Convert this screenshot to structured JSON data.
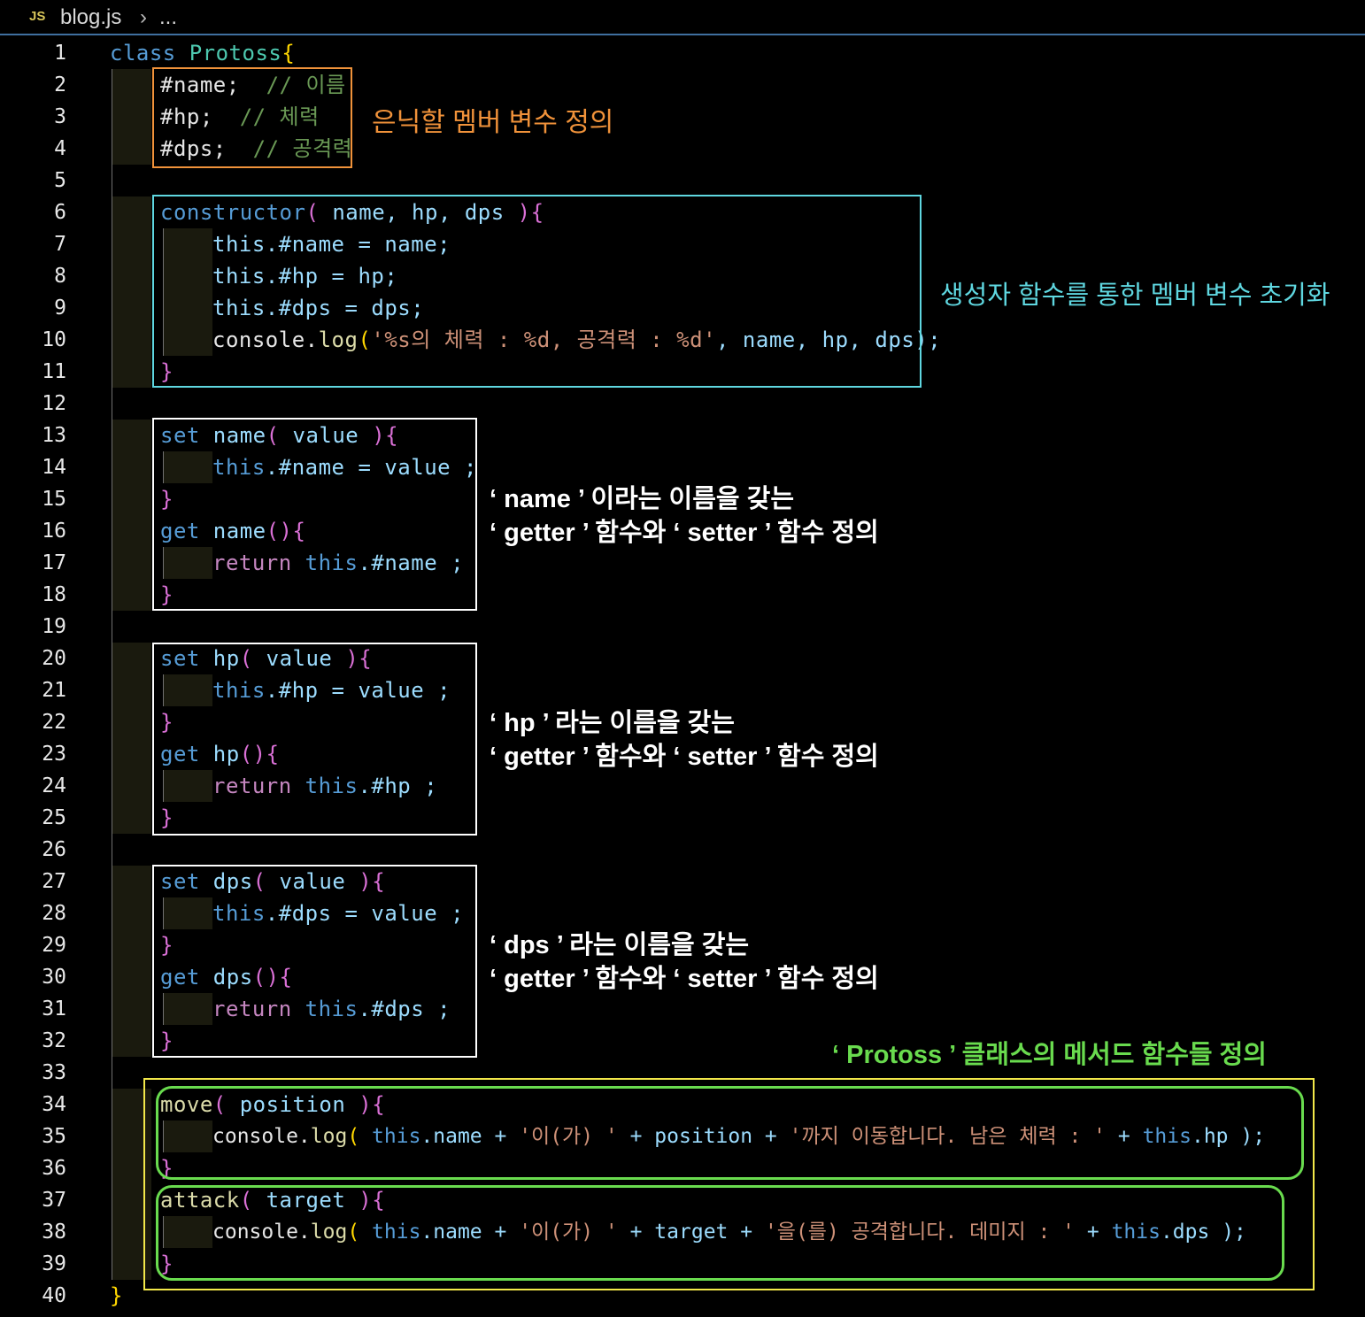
{
  "tab": {
    "icon_text": "JS",
    "filename": "blog.js",
    "chevron": "›",
    "more": "..."
  },
  "line_numbers": [
    "1",
    "2",
    "3",
    "4",
    "5",
    "6",
    "7",
    "8",
    "9",
    "10",
    "11",
    "12",
    "13",
    "14",
    "15",
    "16",
    "17",
    "18",
    "19",
    "20",
    "21",
    "22",
    "23",
    "24",
    "25",
    "26",
    "27",
    "28",
    "29",
    "30",
    "31",
    "32",
    "33",
    "34",
    "35",
    "36",
    "37",
    "38",
    "39",
    "40"
  ],
  "code": {
    "l1_class": "class",
    "l1_name": "Protoss",
    "l1_brace": "{",
    "l2_field": "#name;",
    "l2_comment": "// 이름",
    "l3_field": "#hp;",
    "l3_comment": "// 체력",
    "l4_field": "#dps;",
    "l4_comment": "// 공격력",
    "l6_kw": "constructor",
    "l6_open": "(",
    "l6_params": " name, hp, dps ",
    "l6_close": "){",
    "l7": "this.#name = name;",
    "l8": "this.#hp = hp;",
    "l9": "this.#dps = dps;",
    "l10_a": "console.",
    "l10_b": "log",
    "l10_c": "(",
    "l10_str": "'%s의 체력 : %d, 공격력 : %d'",
    "l10_d": ", name, hp, dps);",
    "close_brace": "}",
    "l13_kw": "set",
    "l13_name": " name",
    "l13_open": "(",
    "l13_param": " value ",
    "l13_close": "){",
    "l14_this": "this",
    "l14_rest": ".#name = value ;",
    "l16_kw": "get",
    "l16_name": " name",
    "l16_close": "(){",
    "l17_ret": "return",
    "l17_this": " this",
    "l17_rest": ".#name ;",
    "l20_kw": "set",
    "l20_name": " hp",
    "l20_open": "(",
    "l20_param": " value ",
    "l20_close": "){",
    "l21_this": "this",
    "l21_rest": ".#hp = value ;",
    "l23_kw": "get",
    "l23_name": " hp",
    "l23_close": "(){",
    "l24_ret": "return",
    "l24_this": " this",
    "l24_rest": ".#hp ;",
    "l27_kw": "set",
    "l27_name": " dps",
    "l27_open": "(",
    "l27_param": " value ",
    "l27_close": "){",
    "l28_this": "this",
    "l28_rest": ".#dps = value ;",
    "l30_kw": "get",
    "l30_name": " dps",
    "l30_close": "(){",
    "l31_ret": "return",
    "l31_this": " this",
    "l31_rest": ".#dps ;",
    "l34_fn": "move",
    "l34_open": "(",
    "l34_param": " position ",
    "l34_close": "){",
    "l35_a": "console.",
    "l35_b": "log",
    "l35_c": "( ",
    "l35_this": "this",
    "l35_d": ".name + ",
    "l35_s1": "'이(가) '",
    "l35_e": " + position + ",
    "l35_s2": "'까지 이동합니다. 남은 체력 : '",
    "l35_f": " + ",
    "l35_this2": "this",
    "l35_g": ".hp );",
    "l37_fn": "attack",
    "l37_open": "(",
    "l37_param": " target ",
    "l37_close": "){",
    "l38_a": "console.",
    "l38_b": "log",
    "l38_c": "( ",
    "l38_this": "this",
    "l38_d": ".name + ",
    "l38_s1": "'이(가) '",
    "l38_e": " + target + ",
    "l38_s2": "'을(를) 공격합니다. 데미지 : '",
    "l38_f": " + ",
    "l38_this2": "this",
    "l38_g": ".dps );",
    "l40_brace": "}"
  },
  "annotations": {
    "private_fields": "은닉할 멤버 변수 정의",
    "constructor": "생성자 함수를 통한 멤버 변수 초기화",
    "name_line1": "‘ name ’ 이라는 이름을 갖는",
    "name_line2": "‘ getter ’ 함수와 ‘ setter ’ 함수 정의",
    "hp_line1": "‘ hp ’ 라는 이름을 갖는",
    "hp_line2": "‘ getter ’ 함수와 ‘ setter ’ 함수 정의",
    "dps_line1": "‘ dps ’ 라는 이름을 갖는",
    "dps_line2": "‘ getter ’ 함수와 ‘ setter ’ 함수 정의",
    "methods": "‘ Protoss ’ 클래스의 메서드 함수들 정의"
  },
  "colors": {
    "orange_box": "#f0923a",
    "cyan_box": "#5fd7e0",
    "white_box": "#ffffff",
    "yellow_box": "#f2e84a",
    "green_box": "#69db4e"
  }
}
